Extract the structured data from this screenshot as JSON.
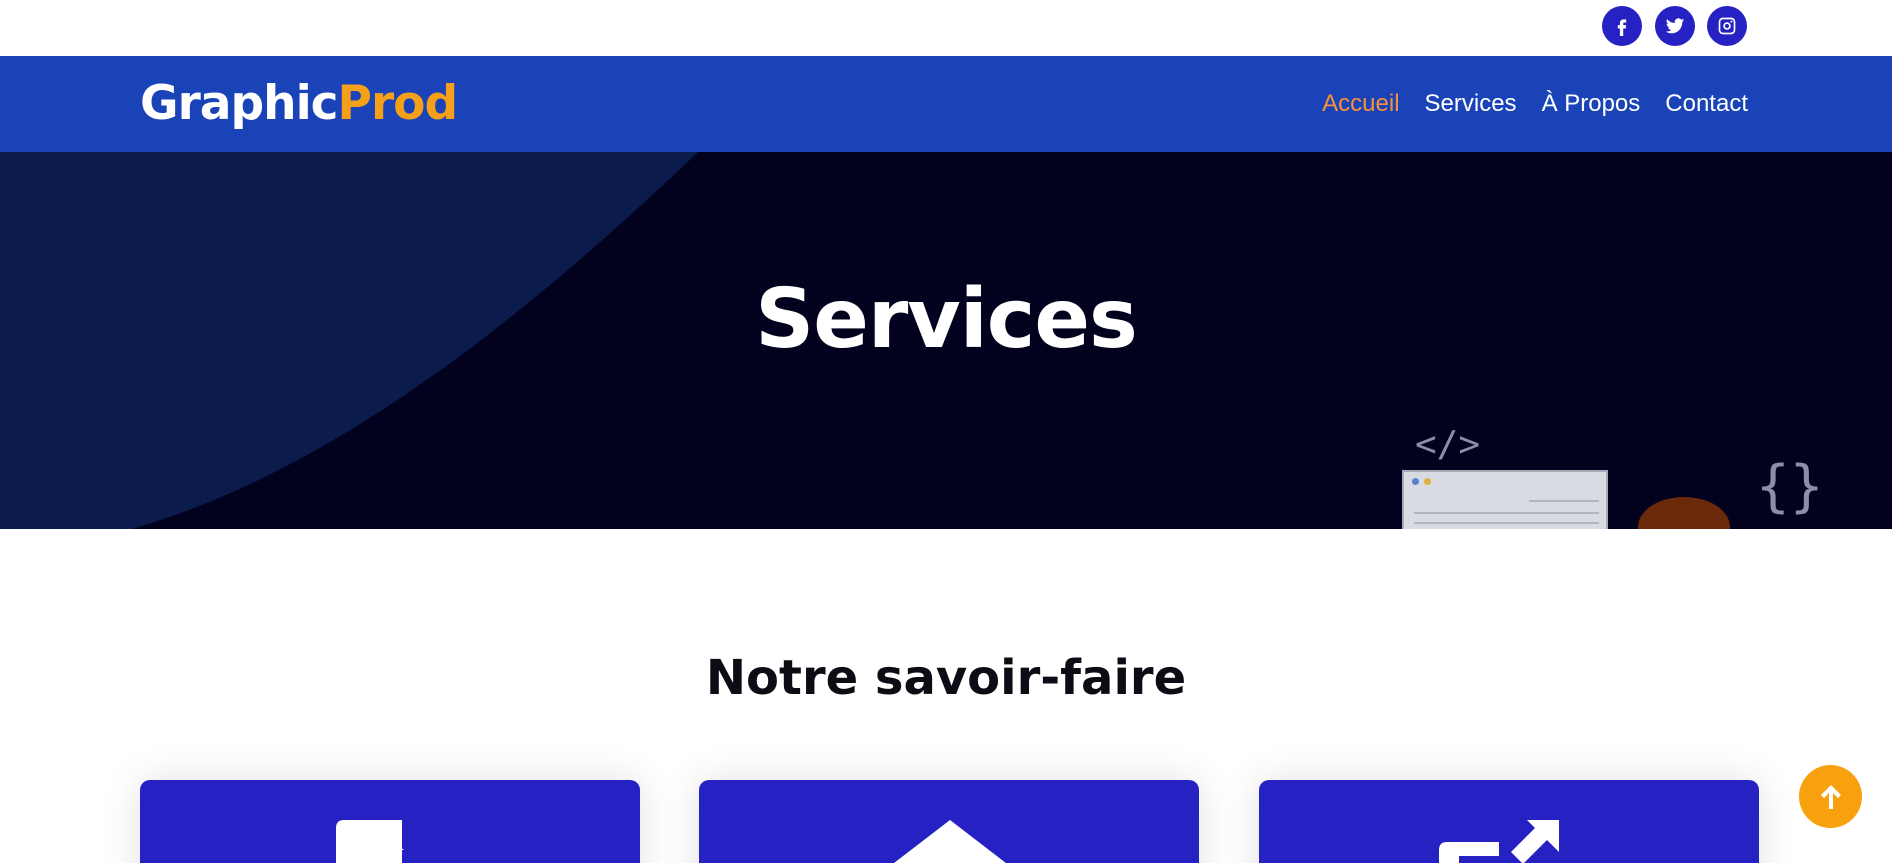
{
  "header": {
    "social": {
      "facebook_icon": "facebook-icon",
      "twitter_icon": "twitter-icon",
      "instagram_icon": "instagram-icon"
    },
    "logo": {
      "part1": "Graphic",
      "part2": "Prod"
    },
    "nav": {
      "accueil": "Accueil",
      "services": "Services",
      "apropos": "À Propos",
      "contact": "Contact"
    }
  },
  "hero": {
    "title": "Services",
    "code_tag": "</>",
    "braces": "{}"
  },
  "section": {
    "title": "Notre savoir-faire",
    "cards": [
      {
        "icon": "document-icon"
      },
      {
        "icon": "house-icon"
      },
      {
        "icon": "share-arrow-icon"
      }
    ]
  },
  "scroll_top": {
    "icon": "arrow-up-icon"
  },
  "colors": {
    "nav_bg": "#1a43b8",
    "accent_orange": "#f6a01a",
    "active_link": "#f6903b",
    "card_blue": "#2521c2",
    "hero_bg": "#02021e"
  }
}
